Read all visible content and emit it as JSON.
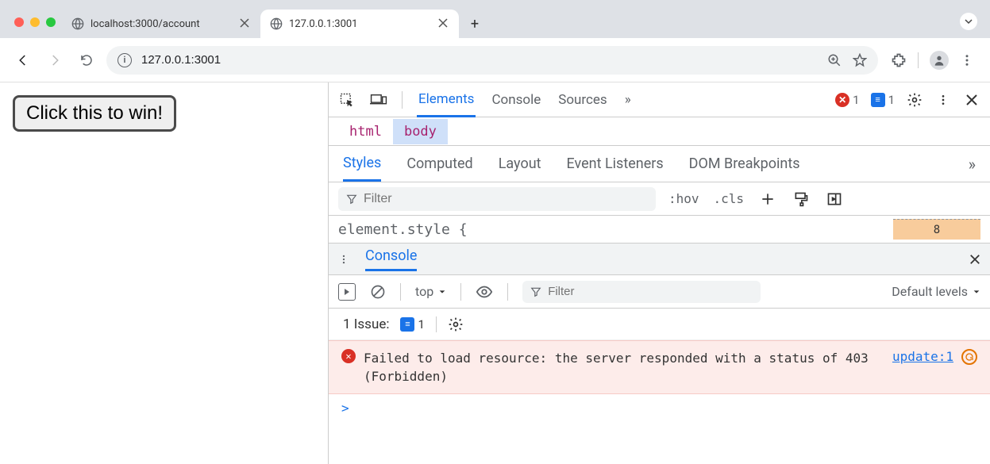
{
  "browser": {
    "tabs": [
      {
        "title": "localhost:3000/account",
        "active": false
      },
      {
        "title": "127.0.0.1:3001",
        "active": true
      }
    ],
    "url": "127.0.0.1:3001"
  },
  "page": {
    "button_label": "Click this to win!"
  },
  "devtools": {
    "tabs": {
      "elements": "Elements",
      "console": "Console",
      "sources": "Sources"
    },
    "more_chevron": "»",
    "error_count": "1",
    "info_count": "1",
    "breadcrumb": {
      "html": "html",
      "body": "body"
    },
    "subtabs": {
      "styles": "Styles",
      "computed": "Computed",
      "layout": "Layout",
      "event": "Event Listeners",
      "dom": "DOM Breakpoints"
    },
    "filter_placeholder": "Filter",
    "hov": ":hov",
    "cls": ".cls",
    "element_style": "element.style {",
    "box_value": "8"
  },
  "drawer": {
    "tab": "Console",
    "context": "top",
    "filter_placeholder": "Filter",
    "levels": "Default levels",
    "issues_label": "1 Issue:",
    "issues_count": "1",
    "error_msg": "Failed to load resource: the server responded with a status of 403 (Forbidden)",
    "error_link": "update:1",
    "prompt": ">"
  }
}
